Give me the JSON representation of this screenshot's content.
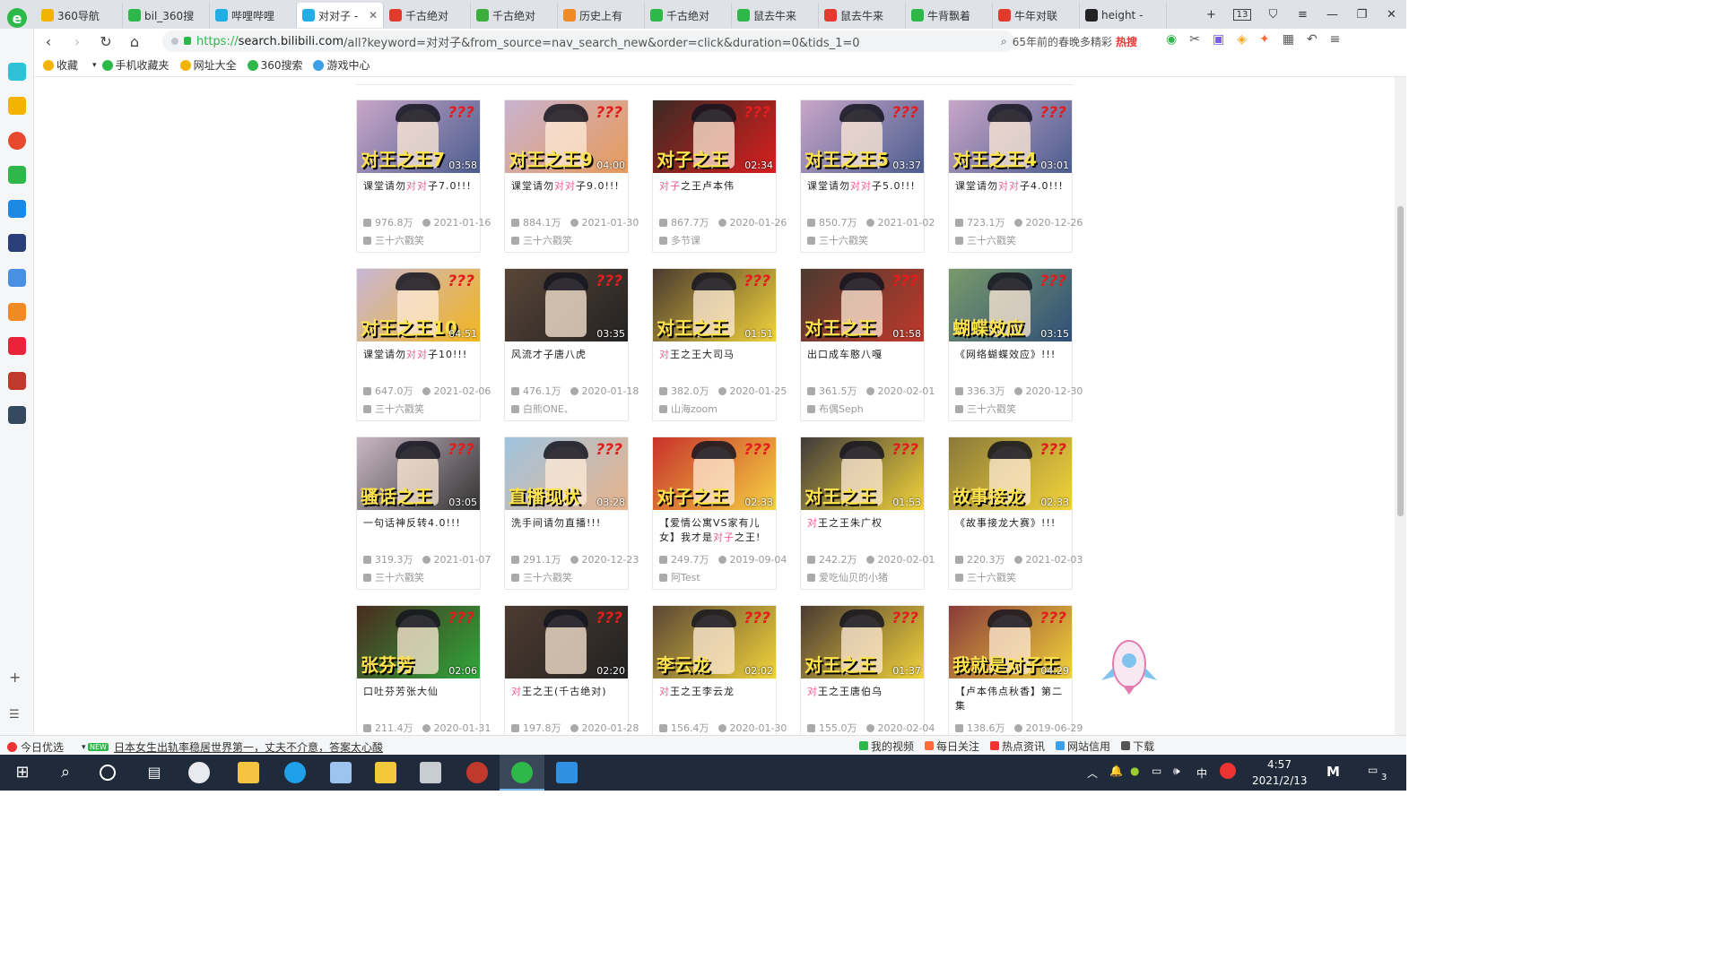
{
  "browser": {
    "tabs": [
      {
        "label": "360导航",
        "icon_color": "#f5b301"
      },
      {
        "label": "bil_360搜",
        "icon_color": "#2fb84a"
      },
      {
        "label": "哔哩哔哩",
        "icon_color": "#23ade5"
      },
      {
        "label": "对对子 -",
        "icon_color": "#23ade5",
        "active": true
      },
      {
        "label": "千古绝对",
        "icon_color": "#e23b2e"
      },
      {
        "label": "千古绝对",
        "icon_color": "#3cae3c"
      },
      {
        "label": "历史上有",
        "icon_color": "#f08a24"
      },
      {
        "label": "千古绝对",
        "icon_color": "#2fb84a"
      },
      {
        "label": "鼠去牛来",
        "icon_color": "#2fb84a"
      },
      {
        "label": "鼠去牛来",
        "icon_color": "#e23b2e"
      },
      {
        "label": "牛背飘着",
        "icon_color": "#2fb84a"
      },
      {
        "label": "牛年对联",
        "icon_color": "#e23b2e"
      },
      {
        "label": "height -",
        "icon_color": "#222222"
      }
    ],
    "tab_count": "13",
    "url": {
      "scheme": "https://",
      "host": "search.bilibili.com",
      "path": "/all?keyword=对对子&from_source=nav_search_new&order=click&duration=0&tids_1=0"
    },
    "hot_search": "65年前的春晚多精彩",
    "hot_badge": "热搜",
    "favorites": [
      {
        "label": "收藏",
        "color": "#f5b301"
      },
      {
        "label": "手机收藏夹",
        "color": "#2fb84a"
      },
      {
        "label": "网址大全",
        "color": "#f5b301"
      },
      {
        "label": "360搜索",
        "color": "#2fb84a"
      },
      {
        "label": "游戏中心",
        "color": "#3aa0e8"
      }
    ]
  },
  "videos": [
    {
      "thumb_title": "对王之王7",
      "bg": "#c9a6c8",
      "accent": "#4b5d8f",
      "title_parts": [
        "课堂请勿",
        "对对",
        "子7.0!!!"
      ],
      "views": "976.8万",
      "date": "2021-01-16",
      "uploader": "三十六戳笑",
      "duration": "03:58"
    },
    {
      "thumb_title": "对王之王9",
      "bg": "#c8b3d0",
      "accent": "#e89a5a",
      "title_parts": [
        "课堂请勿",
        "对对",
        "子9.0!!!"
      ],
      "views": "884.1万",
      "date": "2021-01-30",
      "uploader": "三十六戳笑",
      "duration": "04:00"
    },
    {
      "thumb_title": "对子之王",
      "bg": "#3b2a24",
      "accent": "#d81e1e",
      "title_parts": [
        "",
        "对子",
        "之王卢本伟"
      ],
      "views": "867.7万",
      "date": "2020-01-26",
      "uploader": "多节课",
      "duration": "02:34"
    },
    {
      "thumb_title": "对王之王5",
      "bg": "#c9a6c8",
      "accent": "#4b5d8f",
      "title_parts": [
        "课堂请勿",
        "对对",
        "子5.0!!!"
      ],
      "views": "850.7万",
      "date": "2021-01-02",
      "uploader": "三十六戳笑",
      "duration": "03:37"
    },
    {
      "thumb_title": "对王之王4",
      "bg": "#c9a6c8",
      "accent": "#4b5d8f",
      "title_parts": [
        "课堂请勿",
        "对对",
        "子4.0!!!"
      ],
      "views": "723.1万",
      "date": "2020-12-26",
      "uploader": "三十六戳笑",
      "duration": "03:01"
    },
    {
      "thumb_title": "对王之王10",
      "bg": "#c8b6d6",
      "accent": "#f2b51c",
      "title_parts": [
        "课堂请勿",
        "对对",
        "子10!!!"
      ],
      "views": "647.0万",
      "date": "2021-02-06",
      "uploader": "三十六戳笑",
      "duration": "04:51"
    },
    {
      "thumb_title": "",
      "bg": "#5a4638",
      "accent": "#222222",
      "title_parts": [
        "风流才子唐八虎",
        "",
        ""
      ],
      "views": "476.1万",
      "date": "2020-01-18",
      "uploader": "白熊ONE、",
      "duration": "03:35"
    },
    {
      "thumb_title": "对王之王",
      "bg": "#4a3a30",
      "accent": "#f2d33a",
      "title_parts": [
        "",
        "对",
        "王之王大司马"
      ],
      "views": "382.0万",
      "date": "2020-01-25",
      "uploader": "山海zoom",
      "duration": "01:51"
    },
    {
      "thumb_title": "对王之王",
      "bg": "#4a3a30",
      "accent": "#c0392b",
      "title_parts": [
        "出口成车憨八嘎",
        "",
        ""
      ],
      "views": "361.5万",
      "date": "2020-02-01",
      "uploader": "布偶Seph",
      "duration": "01:58"
    },
    {
      "thumb_title": "蝴蝶效应",
      "bg": "#7a9a6a",
      "accent": "#2f4f7a",
      "title_parts": [
        "《网络蝴蝶效应》!!!",
        "",
        ""
      ],
      "views": "336.3万",
      "date": "2020-12-30",
      "uploader": "三十六戳笑",
      "duration": "03:15"
    },
    {
      "thumb_title": "骚话之王",
      "bg": "#c9b8c4",
      "accent": "#333333",
      "title_parts": [
        "一句话神反转4.0!!!",
        "",
        ""
      ],
      "views": "319.3万",
      "date": "2021-01-07",
      "uploader": "三十六戳笑",
      "duration": "03:05"
    },
    {
      "thumb_title": "直播现状",
      "bg": "#9fc4e0",
      "accent": "#e8b38a",
      "title_parts": [
        "洗手间请勿直播!!!",
        "",
        ""
      ],
      "views": "291.1万",
      "date": "2020-12-23",
      "uploader": "三十六戳笑",
      "duration": "03:28"
    },
    {
      "thumb_title": "对子之王",
      "bg": "#c8312b",
      "accent": "#f5d142",
      "title_parts": [
        "【爱情公寓VS家有儿女】我才是",
        "对子",
        "之王!"
      ],
      "views": "249.7万",
      "date": "2019-09-04",
      "uploader": "阿Test",
      "duration": "02:33"
    },
    {
      "thumb_title": "对王之王",
      "bg": "#3f3a3a",
      "accent": "#f2d33a",
      "title_parts": [
        "",
        "对",
        "王之王朱广权"
      ],
      "views": "242.2万",
      "date": "2020-02-01",
      "uploader": "爱吃仙贝的小猪",
      "duration": "01:53"
    },
    {
      "thumb_title": "故事接龙",
      "bg": "#8b7a3a",
      "accent": "#f2d33a",
      "title_parts": [
        "《故事接龙大赛》!!!",
        "",
        ""
      ],
      "views": "220.3万",
      "date": "2021-02-03",
      "uploader": "三十六戳笑",
      "duration": "02:33"
    },
    {
      "thumb_title": "张芬芳",
      "bg": "#4a2b20",
      "accent": "#2ea83a",
      "title_parts": [
        "口吐芬芳张大仙",
        "",
        ""
      ],
      "views": "211.4万",
      "date": "2020-01-31",
      "uploader": "",
      "duration": "02:06"
    },
    {
      "thumb_title": "",
      "bg": "#4d3b30",
      "accent": "#222222",
      "title_parts": [
        "",
        "对",
        "王之王(千古绝对)"
      ],
      "views": "197.8万",
      "date": "2020-01-28",
      "uploader": "",
      "duration": "02:20"
    },
    {
      "thumb_title": "李云龙",
      "bg": "#5a4636",
      "accent": "#f2d33a",
      "title_parts": [
        "",
        "对",
        "王之王李云龙"
      ],
      "views": "156.4万",
      "date": "2020-01-30",
      "uploader": "",
      "duration": "02:02"
    },
    {
      "thumb_title": "对王之王",
      "bg": "#4a3a34",
      "accent": "#f2d33a",
      "title_parts": [
        "",
        "对",
        "王之王唐伯乌"
      ],
      "views": "155.0万",
      "date": "2020-02-04",
      "uploader": "",
      "duration": "01:37"
    },
    {
      "thumb_title": "我就是对子王",
      "bg": "#8a3a3a",
      "accent": "#f2d33a",
      "title_parts": [
        "【卢本伟点秋香】第二集",
        "",
        ""
      ],
      "views": "138.6万",
      "date": "2019-06-29",
      "uploader": "",
      "duration": "04:29"
    }
  ],
  "statusbar": {
    "left": "今日优选",
    "news_badge": "NEW",
    "news": "日本女生出轨率稳居世界第一，丈夫不介意，答案太心酸",
    "right": [
      "我的视频",
      "每日关注",
      "热点资讯",
      "网站信用",
      "下载"
    ]
  },
  "taskbar": {
    "time": "4:57",
    "date": "2021/2/13",
    "ime": "中",
    "notif_count": "3"
  }
}
